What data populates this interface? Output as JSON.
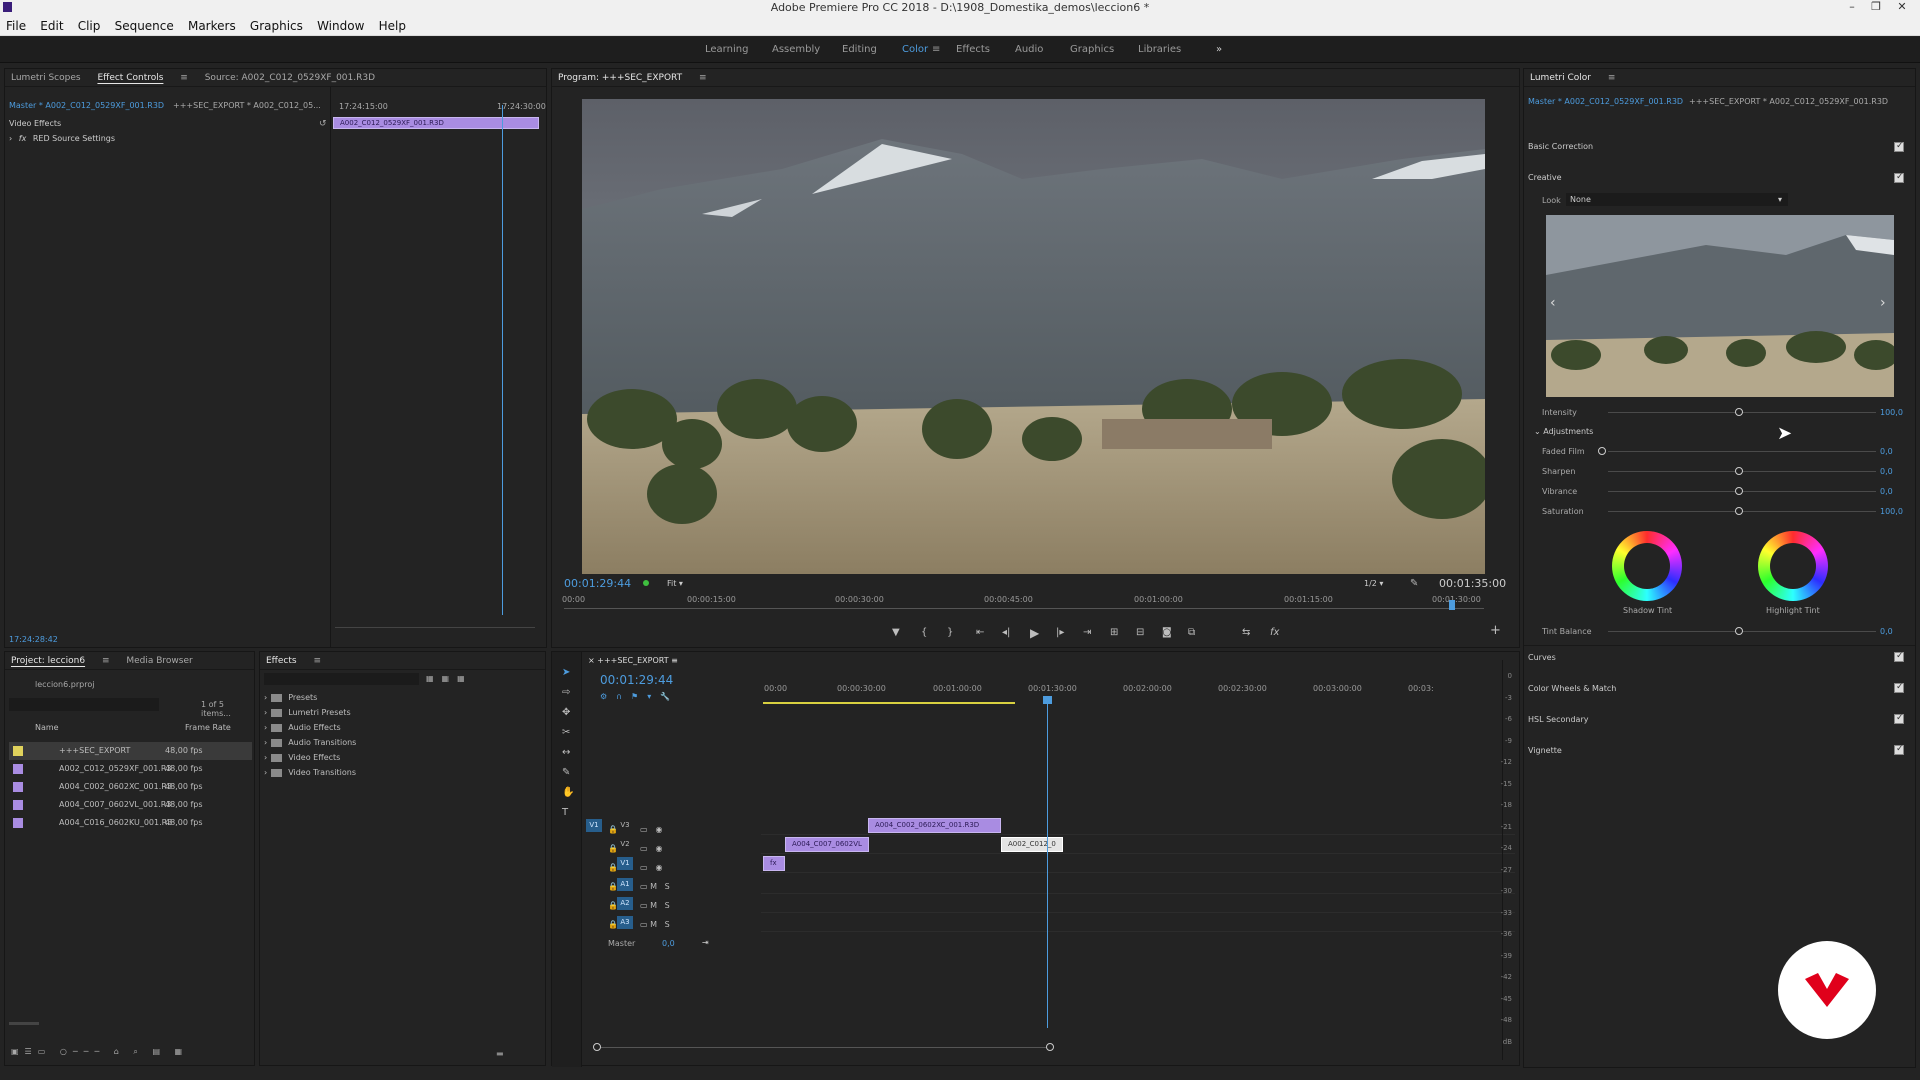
{
  "window": {
    "title": "Adobe Premiere Pro CC 2018 - D:\\1908_Domestika_demos\\leccion6 *",
    "controls": [
      "–",
      "❐",
      "✕"
    ]
  },
  "menu": [
    "File",
    "Edit",
    "Clip",
    "Sequence",
    "Markers",
    "Graphics",
    "Window",
    "Help"
  ],
  "workspaces": [
    "Learning",
    "Assembly",
    "Editing",
    "Color",
    "Effects",
    "Audio",
    "Graphics",
    "Libraries"
  ],
  "workspace_active": "Color",
  "source_panel": {
    "tabs": [
      "Lumetri Scopes",
      "Effect Controls",
      "Source: A002_C012_0529XF_001.R3D"
    ],
    "master_label": "Master * A002_C012_0529XF_001.R3D",
    "sequence_label": "+++SEC_EXPORT * A002_C012_05...",
    "video_effects": "Video Effects",
    "effect_item": "RED Source Settings",
    "time_start": "17:24:15:00",
    "time_end": "17:24:30:00",
    "clip_name": "A002_C012_0529XF_001.R3D",
    "current_time": "17:24:28:42"
  },
  "program": {
    "title": "Program: +++SEC_EXPORT",
    "timecode": "00:01:29:44",
    "fit": "Fit",
    "resolution": "1/2",
    "duration": "00:01:35:00",
    "ruler": [
      "00:00",
      "00:00:15:00",
      "00:00:30:00",
      "00:00:45:00",
      "00:01:00:00",
      "00:01:15:00",
      "00:01:30:00"
    ]
  },
  "lumetri": {
    "title": "Lumetri Color",
    "master": "Master * A002_C012_0529XF_001.R3D",
    "sequence": "+++SEC_EXPORT * A002_C012_0529XF_001.R3D",
    "basic": "Basic Correction",
    "creative": "Creative",
    "look_label": "Look",
    "look_value": "None",
    "intensity_label": "Intensity",
    "intensity": "100,0",
    "adjustments": "Adjustments",
    "faded_film_label": "Faded Film",
    "faded_film": "0,0",
    "sharpen_label": "Sharpen",
    "sharpen": "0,0",
    "vibrance_label": "Vibrance",
    "vibrance": "0,0",
    "saturation_label": "Saturation",
    "saturation": "100,0",
    "shadow_tint": "Shadow Tint",
    "highlight_tint": "Highlight Tint",
    "tint_balance_label": "Tint Balance",
    "tint_balance": "0,0",
    "curves": "Curves",
    "wheels": "Color Wheels & Match",
    "hsl": "HSL Secondary",
    "vignette": "Vignette"
  },
  "project": {
    "tabs": [
      "Project: leccion6",
      "Media Browser"
    ],
    "file": "leccion6.prproj",
    "count": "1 of 5 items...",
    "col_name": "Name",
    "col_rate": "Frame Rate",
    "items": [
      {
        "name": "+++SEC_EXPORT",
        "rate": "48,00 fps",
        "color": "#e0d25c"
      },
      {
        "name": "A002_C012_0529XF_001.R3",
        "rate": "48,00 fps",
        "color": "#a98ce2"
      },
      {
        "name": "A004_C002_0602XC_001.R3",
        "rate": "48,00 fps",
        "color": "#a98ce2"
      },
      {
        "name": "A004_C007_0602VL_001.R3",
        "rate": "48,00 fps",
        "color": "#a98ce2"
      },
      {
        "name": "A004_C016_0602KU_001.R3",
        "rate": "48,00 fps",
        "color": "#a98ce2"
      }
    ]
  },
  "effects": {
    "tab": "Effects",
    "items": [
      "Presets",
      "Lumetri Presets",
      "Audio Effects",
      "Audio Transitions",
      "Video Effects",
      "Video Transitions"
    ]
  },
  "timeline": {
    "tab": "+++SEC_EXPORT",
    "timecode": "00:01:29:44",
    "ruler": [
      "00:00",
      "00:00:30:00",
      "00:01:00:00",
      "00:01:30:00",
      "00:02:00:00",
      "00:02:30:00",
      "00:03:00:00",
      "00:03:"
    ],
    "video_tracks": [
      "V3",
      "V2",
      "V1"
    ],
    "audio_tracks": [
      "A1",
      "A2",
      "A3"
    ],
    "master_label": "Master",
    "master_value": "0,0",
    "clips": {
      "v3": "A004_C002_0602XC_001.R3D",
      "v2a": "A004_C007_0602VL",
      "v2b": "A002_C012_0",
      "v1": "fx"
    },
    "toggles": {
      "m": "M",
      "s": "S"
    },
    "v1_source": "V1"
  },
  "meter_ticks": [
    "0",
    "-3",
    "-6",
    "-9",
    "-12",
    "-15",
    "-18",
    "-21",
    "-24",
    "-27",
    "-30",
    "-33",
    "-36",
    "-39",
    "-42",
    "-45",
    "-48",
    "dB"
  ],
  "colors": {
    "accent": "#4d9cde",
    "clip": "#a98ce2",
    "brand": "#e0001b"
  }
}
